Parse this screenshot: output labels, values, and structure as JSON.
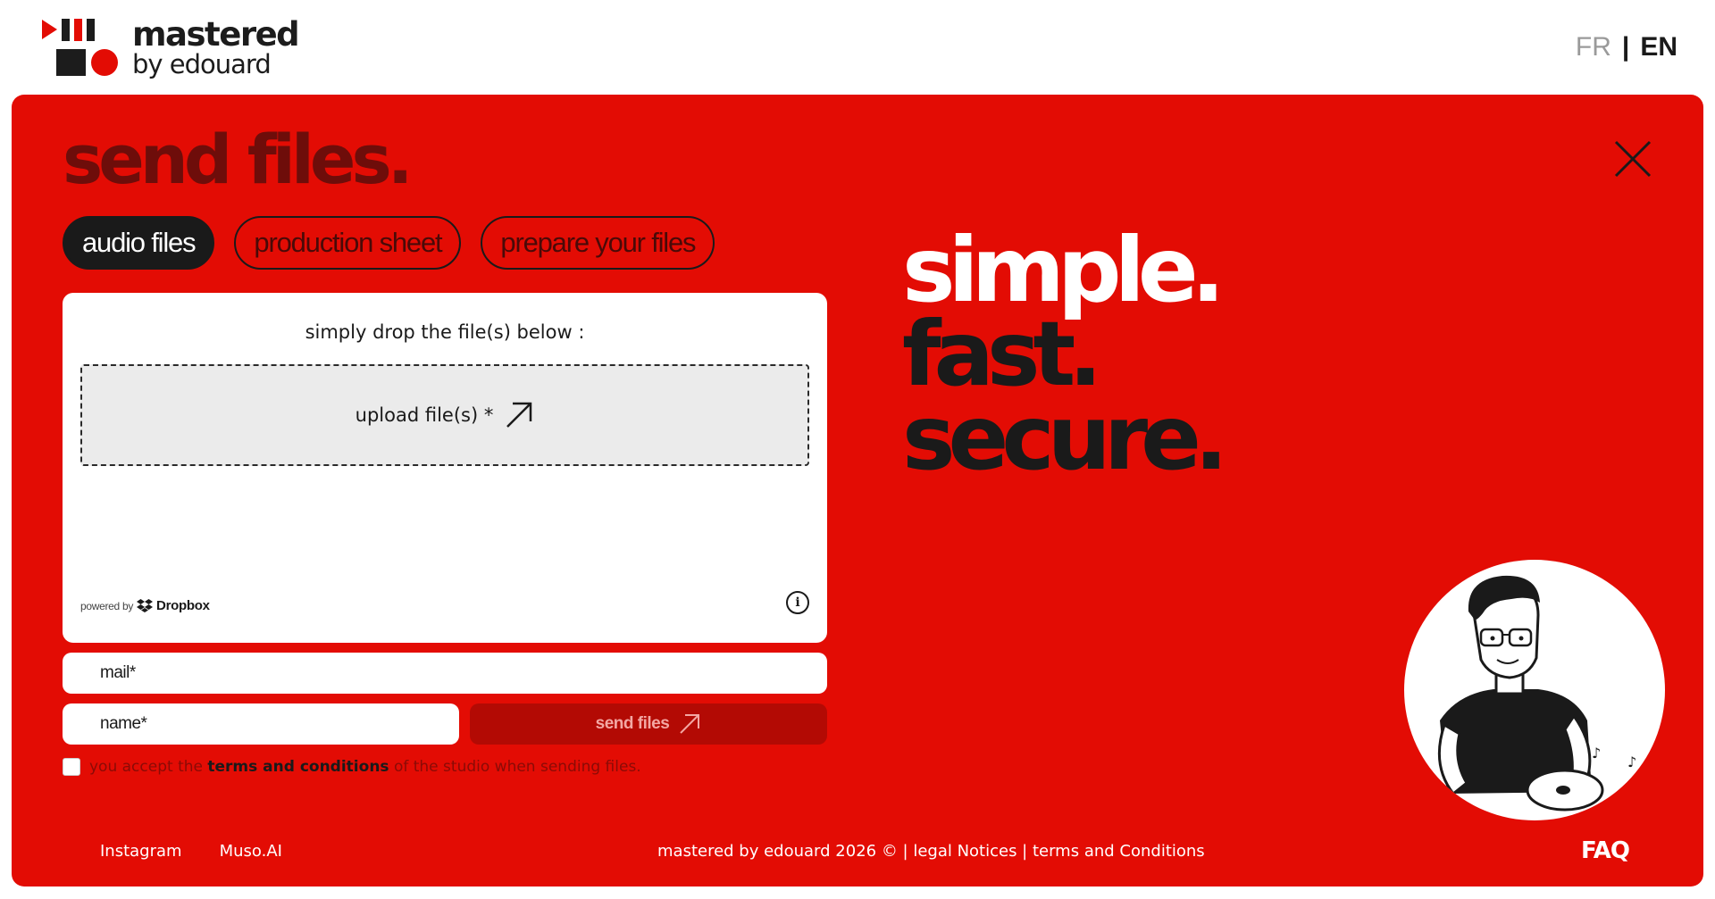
{
  "header": {
    "logo_title": "mastered",
    "logo_subtitle": "by edouard",
    "lang": {
      "fr": "FR",
      "separator": "|",
      "en": "EN"
    }
  },
  "form": {
    "title": "send files.",
    "tabs": [
      {
        "label": "audio files",
        "active": true
      },
      {
        "label": "production sheet",
        "active": false
      },
      {
        "label": "prepare your files",
        "active": false
      }
    ],
    "drop_title": "simply drop the file(s) below :",
    "upload_label": "upload file(s) *",
    "powered_by": "powered by",
    "provider": "Dropbox",
    "info_icon": "i",
    "mail_placeholder": "mail*",
    "name_placeholder": "name*",
    "send_label": "send files",
    "terms_prefix": "you accept the",
    "terms_link": "terms and conditions",
    "terms_suffix": "of the studio when sending files."
  },
  "slogan": {
    "line1": "simple.",
    "line2": "fast.",
    "line3": "secure."
  },
  "footer": {
    "links": [
      "Instagram",
      "Muso.AI"
    ],
    "copyright": "mastered by edouard 2026 © | legal Notices | terms and Conditions",
    "faq": "FAQ"
  },
  "colors": {
    "brand_red": "#e30c04",
    "dark": "#1a1a1a",
    "send_button": "#b30a04"
  },
  "icons": [
    "play-logo-icon",
    "close-icon",
    "arrow-up-right-icon",
    "dropbox-icon",
    "info-icon",
    "avatar-illustration"
  ]
}
